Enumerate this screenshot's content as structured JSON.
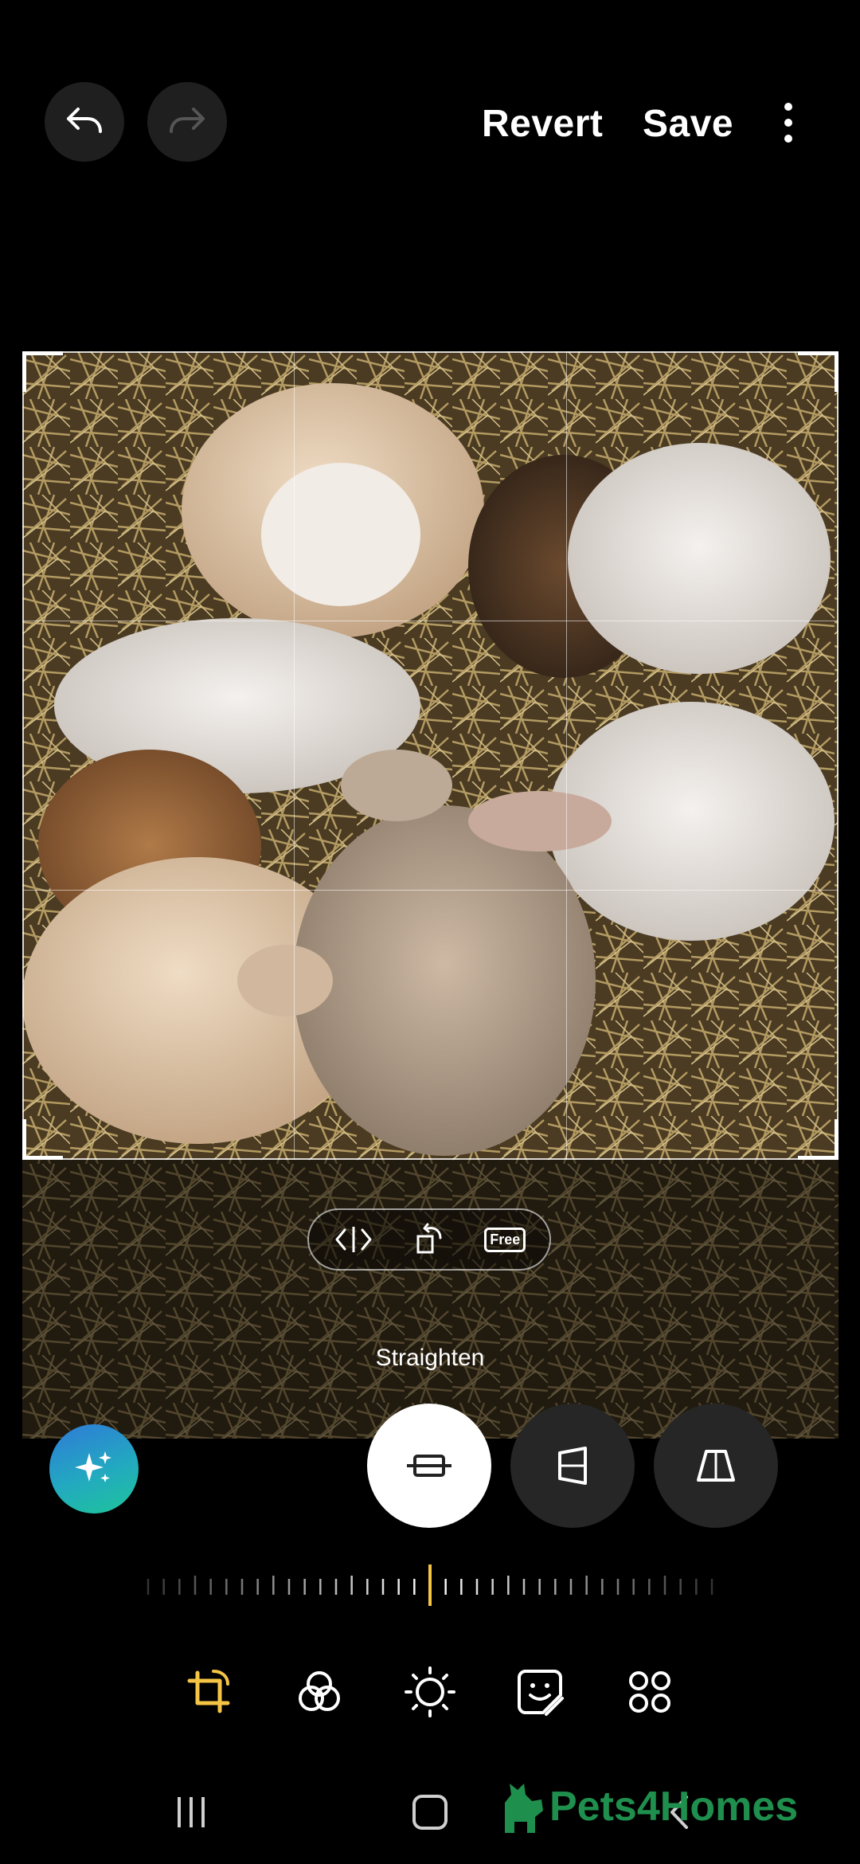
{
  "header": {
    "undo_icon": "undo-arrow-icon",
    "redo_icon": "redo-arrow-icon",
    "revert_label": "Revert",
    "save_label": "Save",
    "more_icon": "vertical-ellipsis-icon"
  },
  "crop_tools": {
    "flip_icon": "flip-horizontal-icon",
    "rotate_icon": "rotate-icon",
    "aspect_label": "Free"
  },
  "adjust": {
    "mode_label": "Straighten",
    "modes": [
      {
        "name": "straighten",
        "icon": "straighten-icon",
        "active": true
      },
      {
        "name": "vertical-perspective",
        "icon": "vertical-perspective-icon",
        "active": false
      },
      {
        "name": "horizontal-perspective",
        "icon": "horizontal-perspective-icon",
        "active": false
      }
    ],
    "ai_icon": "sparkle-icon",
    "ruler_value": 0
  },
  "toolbar": {
    "items": [
      {
        "name": "transform",
        "icon": "crop-rotate-icon",
        "active": true
      },
      {
        "name": "filters",
        "icon": "filters-icon",
        "active": false
      },
      {
        "name": "tone",
        "icon": "brightness-icon",
        "active": false
      },
      {
        "name": "decorations",
        "icon": "sticker-icon",
        "active": false
      },
      {
        "name": "more-tools",
        "icon": "apps-grid-icon",
        "active": false
      }
    ]
  },
  "nav": {
    "recents_icon": "recents-icon",
    "home_icon": "home-icon",
    "back_icon": "back-icon"
  },
  "watermark": {
    "text": "Pets4Homes"
  },
  "colors": {
    "accent": "#f6c445",
    "background": "#000000",
    "button_dark": "#262626",
    "watermark": "#1f8f4e"
  }
}
